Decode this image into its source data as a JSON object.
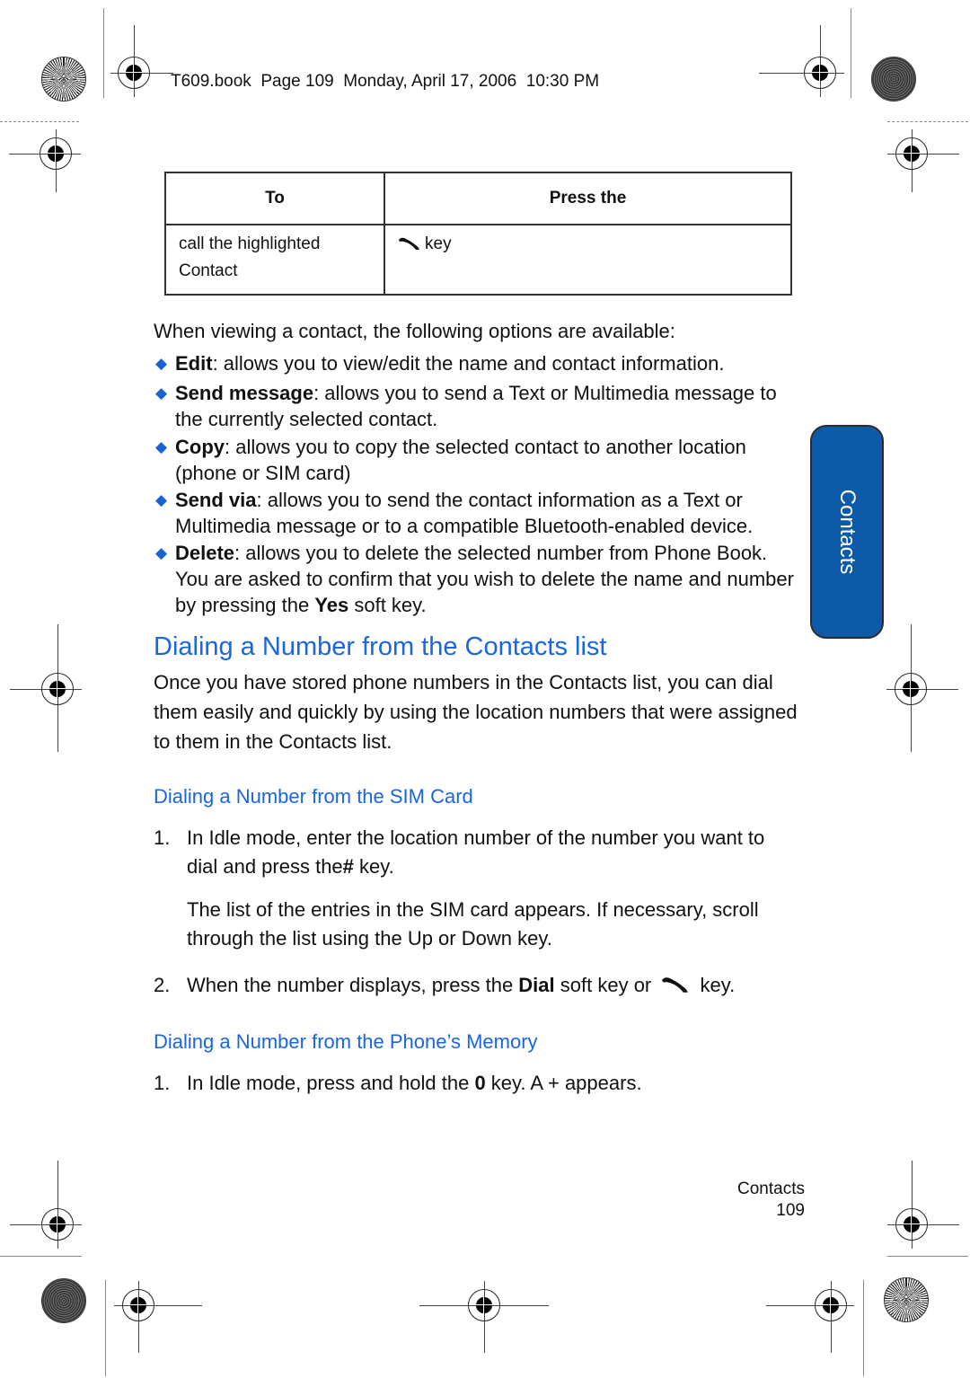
{
  "header": {
    "line": "T609.book  Page 109  Monday, April 17, 2006  10:30 PM"
  },
  "key_table": {
    "headers": [
      "To",
      "Press the"
    ],
    "rows": [
      {
        "to": "call the highlighted Contact",
        "press_icon": "send-key-icon",
        "press_text": "key"
      }
    ]
  },
  "intro": "When viewing a contact, the following options are available:",
  "options": [
    {
      "term": "Edit",
      "desc": ": allows you to view/edit the name and contact information."
    },
    {
      "term": "Send message",
      "desc": ": allows you to send a Text or Multimedia message to the currently selected contact."
    },
    {
      "term": "Copy",
      "desc": ": allows you to copy the selected contact to another location (phone or SIM card)"
    },
    {
      "term": "Send via",
      "desc": ": allows you to send the contact information as a Text or Multimedia message or to a compatible Bluetooth-enabled device."
    },
    {
      "term": "Delete",
      "desc": ": allows you to delete the selected number from Phone Book. You are asked to confirm that you wish to delete the name and number by pressing the ",
      "bold_tail": "Yes",
      "tail": " soft key."
    }
  ],
  "section": {
    "title": "Dialing a Number from the Contacts list",
    "body": "Once you have stored phone numbers in the Contacts list, you can dial them easily and quickly by using the location numbers that were assigned to them in the Contacts list."
  },
  "sim_card": {
    "title": "Dialing a Number from the SIM Card",
    "steps": [
      {
        "num": "1.",
        "pre": "In Idle mode, enter the location number of the number you want to dial and press the",
        "key": "#",
        "post": " key."
      },
      {
        "note": "The list of the entries in the SIM card appears. If necessary, scroll through the list using the Up or Down key."
      },
      {
        "num": "2.",
        "pre": "When the number displays, press the ",
        "key": "Dial",
        "mid": " soft key or ",
        "icon": "send-key-icon",
        "post": " key."
      }
    ]
  },
  "phone_memory": {
    "title": "Dialing a Number from the Phone’s Memory",
    "steps": [
      {
        "num": "1.",
        "pre": "In Idle mode, press and hold the ",
        "key": "0",
        "post": " key. A + appears."
      }
    ]
  },
  "side_tab": {
    "label": "Contacts",
    "color": "#0c5aa8"
  },
  "footer": {
    "section": "Contacts",
    "page": "109"
  },
  "colors": {
    "heading": "#1a66e0",
    "bullet": "#1463d1"
  }
}
